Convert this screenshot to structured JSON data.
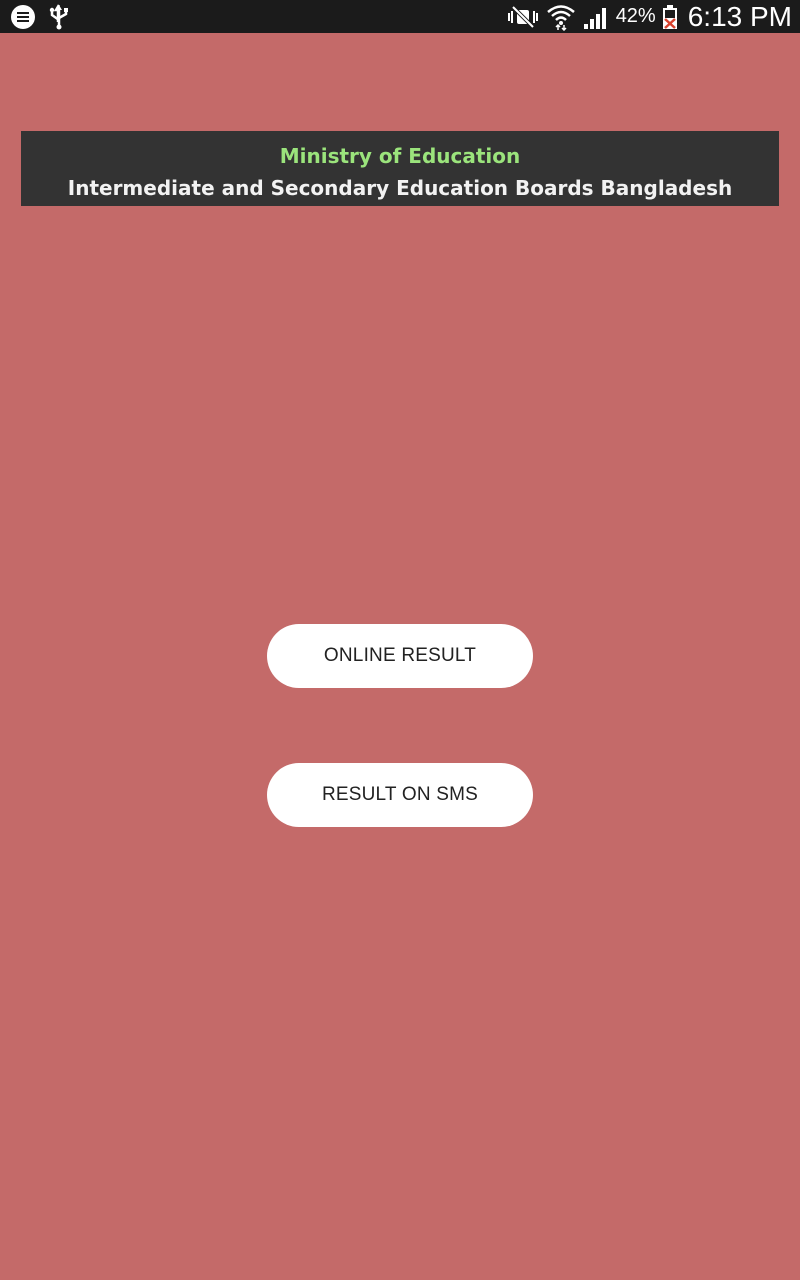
{
  "status_bar": {
    "battery_percent": "42%",
    "time": "6:13 PM",
    "icons": [
      "chat-icon",
      "usb-icon",
      "mute-icon",
      "wifi-icon",
      "signal-icon",
      "battery-icon"
    ]
  },
  "banner": {
    "title": "Ministry of Education",
    "subtitle": "Intermediate and Secondary Education Boards Bangladesh",
    "title_color": "#9be47c"
  },
  "actions": {
    "online_result_label": "ONLINE RESULT",
    "result_on_sms_label": "RESULT ON SMS"
  },
  "colors": {
    "background": "#c46a69",
    "banner_bg": "#333333",
    "button_bg": "#ffffff"
  }
}
